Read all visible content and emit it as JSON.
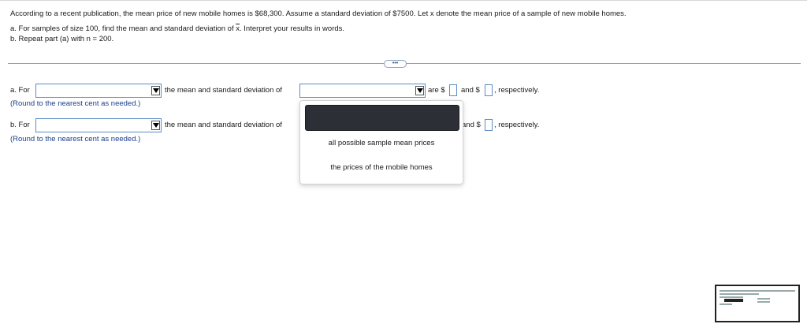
{
  "question": {
    "main": "According to a recent publication, the mean price of new mobile homes is $68,300. Assume a standard deviation of $7500. Let x denote the mean price of a sample of new mobile homes.",
    "main_xbar": "x",
    "part_a_prefix": "a. For samples of size 100, find the mean and standard deviation of ",
    "part_a_xbar": "x",
    "part_a_suffix": ". Interpret your results in words.",
    "part_b": "b. Repeat part (a) with n = 200."
  },
  "more_button": "•••",
  "part_a": {
    "label": "a. For",
    "text1": "the mean and standard deviation of",
    "text2": "are $",
    "text3": "and $",
    "text4": ", respectively.",
    "hint": "(Round to the nearest cent as needed.)"
  },
  "part_b": {
    "label": "b. For",
    "text1": "the mean and standard deviation of",
    "text3": "and $",
    "text4": ", respectively.",
    "hint": "(Round to the nearest cent as needed.)"
  },
  "dropdown": {
    "options": [
      "all possible sample mean prices",
      "the prices of the mobile homes"
    ]
  }
}
